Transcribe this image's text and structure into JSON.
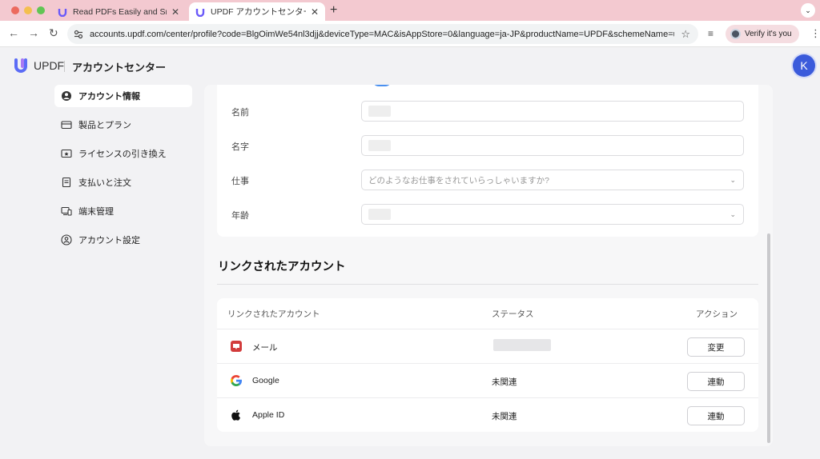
{
  "browser": {
    "tabs": [
      {
        "title": "Read PDFs Easily and Smartly",
        "active": false
      },
      {
        "title": "UPDF アカウントセンター",
        "active": true
      }
    ],
    "url": "accounts.updf.com/center/profile?code=BlgOimWe54nl3djj&deviceType=MAC&isAppStore=0&language=ja-JP&productName=UPDF&schemeName=up...",
    "verify_label": "Verify it's you"
  },
  "header": {
    "brand": "UPDF",
    "title": "アカウントセンター",
    "avatar_letter": "K"
  },
  "sidebar": {
    "items": [
      {
        "label": "アカウント情報",
        "icon": "user-circle-icon",
        "active": true
      },
      {
        "label": "製品とプラン",
        "icon": "card-icon",
        "active": false
      },
      {
        "label": "ライセンスの引き換え",
        "icon": "license-icon",
        "active": false
      },
      {
        "label": "支払いと注文",
        "icon": "receipt-icon",
        "active": false
      },
      {
        "label": "端末管理",
        "icon": "devices-icon",
        "active": false
      },
      {
        "label": "アカウント設定",
        "icon": "user-settings-icon",
        "active": false
      }
    ]
  },
  "profile": {
    "fields": [
      {
        "label": "名前",
        "value": "",
        "placeholder": ""
      },
      {
        "label": "名字",
        "value": "",
        "placeholder": ""
      },
      {
        "label": "仕事",
        "value": "",
        "placeholder": "どのようなお仕事をされていらっしゃいますか?"
      },
      {
        "label": "年齢",
        "value": "",
        "placeholder": ""
      }
    ]
  },
  "linked": {
    "section_title": "リンクされたアカウント",
    "columns": [
      "リンクされたアカウント",
      "ステータス",
      "アクション"
    ],
    "rows": [
      {
        "name": "メール",
        "icon": "mail-icon",
        "status": "",
        "action": "変更"
      },
      {
        "name": "Google",
        "icon": "google-icon",
        "status": "未関連",
        "action": "連動"
      },
      {
        "name": "Apple ID",
        "icon": "apple-icon",
        "status": "未関連",
        "action": "連動"
      }
    ]
  },
  "colors": {
    "accent": "#3b5bdb",
    "tabbar": "#f3c9d0",
    "page_bg": "#f2f2f4"
  }
}
